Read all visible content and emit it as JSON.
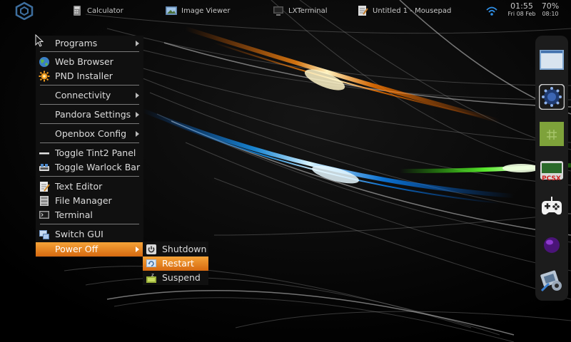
{
  "taskbar": {
    "tasks": [
      {
        "label": "Calculator",
        "icon": "calculator-icon"
      },
      {
        "label": "Image Viewer",
        "icon": "image-viewer-icon"
      },
      {
        "label": "LXTerminal",
        "icon": "terminal-icon"
      },
      {
        "label": "Untitled 1 - Mousepad",
        "icon": "text-editor-icon"
      }
    ],
    "clock": {
      "time": "01:55",
      "date": "Fri 08 Feb"
    },
    "battery": {
      "percent": "70%",
      "time": "08:10"
    }
  },
  "main_menu": {
    "items": [
      {
        "label": "Programs",
        "submenu": true
      },
      {
        "label": "Web Browser",
        "icon": "globe-icon"
      },
      {
        "label": "PND Installer",
        "icon": "pnd-installer-icon"
      },
      {
        "label": "Connectivity",
        "submenu": true
      },
      {
        "label": "Pandora Settings",
        "submenu": true
      },
      {
        "label": "Openbox Config",
        "submenu": true
      },
      {
        "label": "Toggle Tint2 Panel",
        "icon": "panel-toggle-icon"
      },
      {
        "label": "Toggle Warlock Bar",
        "icon": "warlock-bar-icon"
      },
      {
        "label": "Text Editor",
        "icon": "text-editor-icon"
      },
      {
        "label": "File Manager",
        "icon": "file-manager-icon"
      },
      {
        "label": "Terminal",
        "icon": "terminal-icon"
      },
      {
        "label": "Switch GUI",
        "icon": "switch-gui-icon"
      },
      {
        "label": "Power Off",
        "submenu": true,
        "active": true
      }
    ]
  },
  "power_menu": {
    "items": [
      {
        "label": "Shutdown",
        "icon": "shutdown-icon"
      },
      {
        "label": "Restart",
        "icon": "restart-icon",
        "active": true
      },
      {
        "label": "Suspend",
        "icon": "suspend-icon"
      }
    ]
  },
  "dock": {
    "items": [
      {
        "icon": "window-app-icon"
      },
      {
        "icon": "blue-gear-app-icon"
      },
      {
        "icon": "green-square-app-icon"
      },
      {
        "icon": "pcsx-app-icon"
      },
      {
        "icon": "gamepad-icon"
      },
      {
        "icon": "purple-orb-app-icon"
      },
      {
        "icon": "film-settings-icon"
      }
    ]
  },
  "colors": {
    "menu_highlight": "#e8851f",
    "menu_background": "#101010",
    "dock_background": "#1c1c1c"
  }
}
